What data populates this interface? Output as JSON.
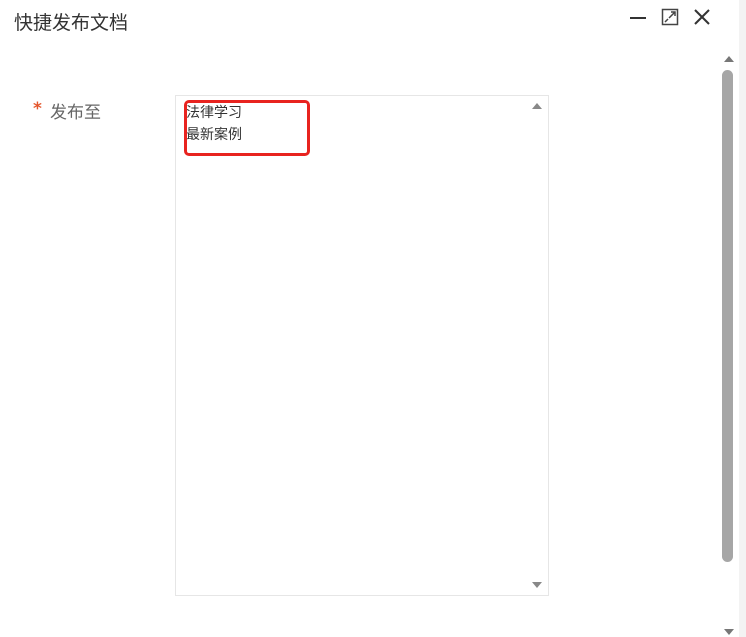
{
  "dialog": {
    "title": "快捷发布文档",
    "controls": {
      "minimize_icon": "minimize-icon",
      "maximize_icon": "maximize-icon",
      "close_icon": "close-icon"
    }
  },
  "form": {
    "required_mark": "*",
    "publish_to_label": "发布至",
    "publish_to_options": [
      "法律学习",
      "最新案例"
    ]
  },
  "colors": {
    "required": "#e4572e",
    "highlight_border": "#e8231f",
    "scrollbar_thumb": "#a6a6a6"
  }
}
